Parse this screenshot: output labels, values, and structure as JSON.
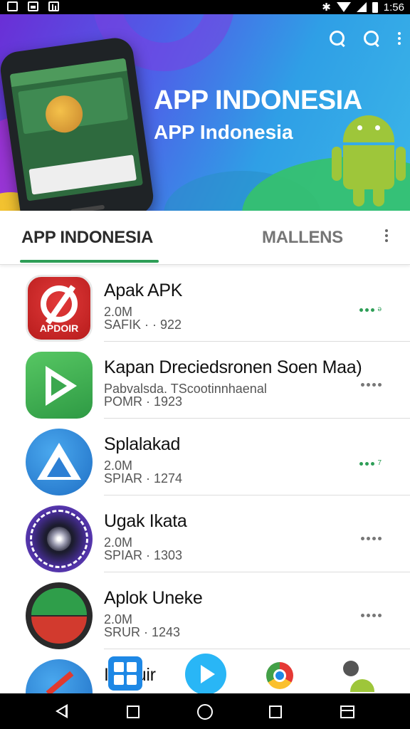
{
  "status_bar": {
    "time": "1:56",
    "icons": [
      "screenshot-icon",
      "gallery-icon",
      "stats-icon",
      "bluetooth-icon",
      "wifi-icon",
      "signal-icon",
      "battery-icon"
    ]
  },
  "header": {
    "title": "APP INDONESIA",
    "subtitle": "APP Indonesia",
    "actions": [
      "search-icon",
      "search-icon",
      "overflow-menu-icon"
    ]
  },
  "tabs": [
    {
      "label": "APP INDONESIA",
      "active": true
    },
    {
      "label": "MALLENS",
      "active": false
    }
  ],
  "apps": [
    {
      "name": "Apak APK",
      "line2": "2.0M",
      "line3": "SAFIK · · 922",
      "icon_text": "APDOIR",
      "icon": "red-circle-logo-icon",
      "more": "green"
    },
    {
      "name": "Kapan Dreciedsronen Soen Maa)",
      "line2": "Pabvalsda. TScootinnhaenal",
      "line3": "POMR · 1923",
      "icon": "green-play-icon",
      "more": "gray"
    },
    {
      "name": "Splalakad",
      "line2": "2.0M",
      "line3": "SPIAR · 1274",
      "icon": "blue-triangle-icon",
      "more": "green"
    },
    {
      "name": "Ugak Ikata",
      "line2": "2.0M",
      "line3": "SPIAR · 1303",
      "icon": "zodiac-wheel-icon",
      "more": "gray"
    },
    {
      "name": "Aplok Uneke",
      "line2": "2.0M",
      "line3": "SRUR · 1243",
      "icon": "green-red-circle-icon",
      "more": "gray"
    },
    {
      "name": "I Tinuir",
      "line2": "",
      "line3": "",
      "icon": "blue-arrow-icon",
      "more": "none"
    }
  ],
  "accent": "#2e9e57",
  "dock": [
    "apps-grid-icon",
    "play-store-icon",
    "chrome-icon",
    "android-icon"
  ],
  "nav": [
    "back-icon",
    "square-icon",
    "home-icon",
    "recents-icon",
    "window-icon"
  ]
}
